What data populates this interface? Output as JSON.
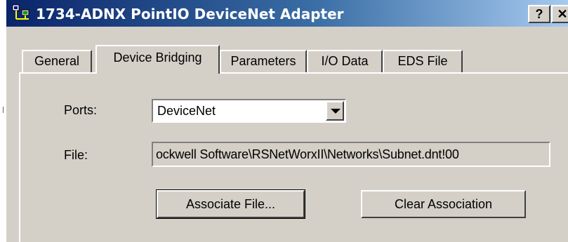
{
  "window": {
    "title": "1734-ADNX PointIO DeviceNet Adapter",
    "help_label": "?",
    "close_label": "✕",
    "icon": "devicenet-adapter-icon"
  },
  "tabs": [
    {
      "label": "General",
      "active": false
    },
    {
      "label": "Device Bridging",
      "active": true
    },
    {
      "label": "Parameters",
      "active": false
    },
    {
      "label": "I/O Data",
      "active": false
    },
    {
      "label": "EDS File",
      "active": false
    }
  ],
  "device_bridging": {
    "ports_label": "Ports:",
    "ports_value": "DeviceNet",
    "file_label": "File:",
    "file_value": "ockwell Software\\RSNetWorxII\\Networks\\Subnet.dnt!00",
    "associate_button": "Associate File...",
    "clear_button": "Clear Association"
  },
  "colors": {
    "title_gradient_start": "#0a246a",
    "title_gradient_end": "#a6caf0",
    "face": "#d4d0c8"
  }
}
